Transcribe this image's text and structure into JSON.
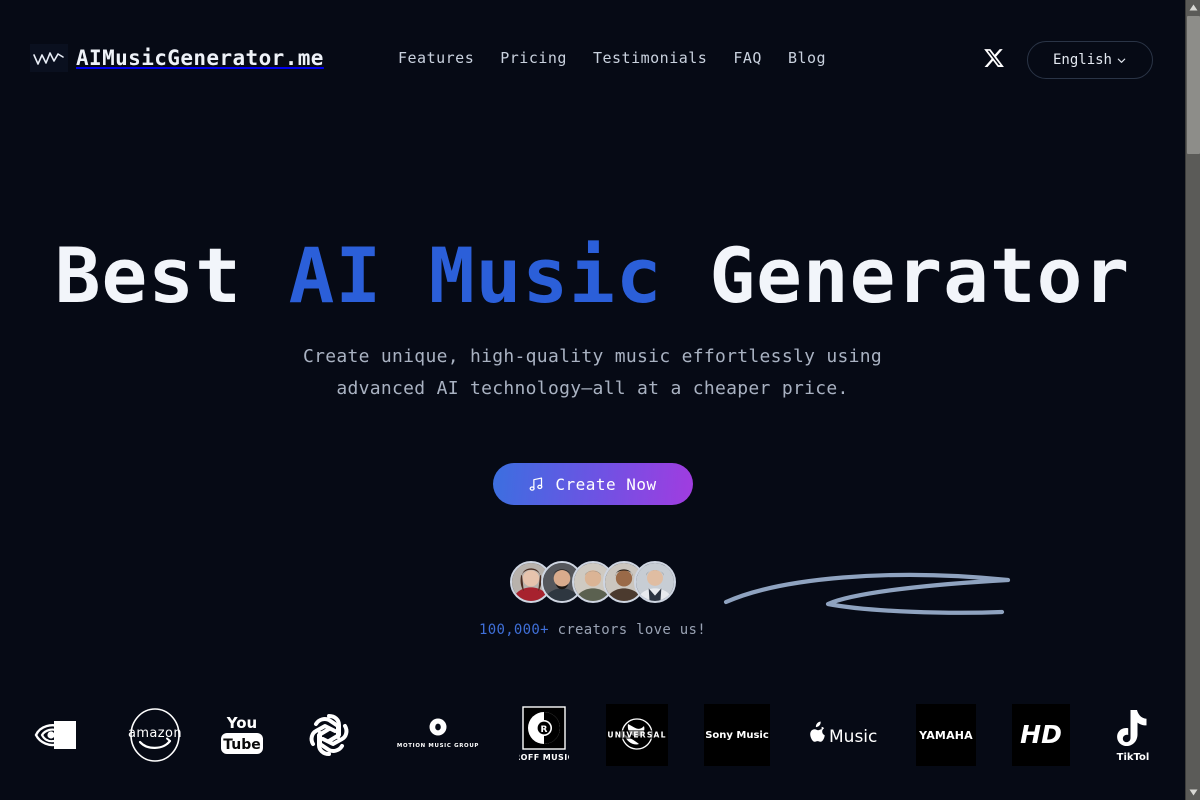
{
  "page": {
    "background_color": "#060a15",
    "accent_blue": "#2b5fd9",
    "cta_gradient_from": "#3b6fe0",
    "cta_gradient_to": "#a13ce0"
  },
  "header": {
    "brand_name": "AIMusicGenerator.me",
    "brand_icon": "waveform-icon",
    "nav": [
      {
        "label": "Features"
      },
      {
        "label": "Pricing"
      },
      {
        "label": "Testimonials"
      },
      {
        "label": "FAQ"
      },
      {
        "label": "Blog"
      }
    ],
    "social": {
      "icon": "x-twitter-icon",
      "label": "X"
    },
    "language": {
      "label": "English",
      "icon": "chevron-down-icon"
    }
  },
  "hero": {
    "headline_part1": "Best ",
    "headline_accent": "AI Music",
    "headline_part2": " Generator",
    "subtitle_line1": "Create unique, high-quality music effortlessly using",
    "subtitle_line2": "advanced AI technology—all at a cheaper price.",
    "cta_label": "Create Now",
    "cta_icon": "music-note-icon",
    "social_proof_count": "100,000+",
    "social_proof_text": " creators love us!",
    "avatar_count": 5
  },
  "logos": [
    {
      "name": "nvidia-logo",
      "label": "NVIDIA"
    },
    {
      "name": "amazon-logo",
      "label": "amazon"
    },
    {
      "name": "youtube-logo",
      "label": "You Tube"
    },
    {
      "name": "openai-logo",
      "label": "OpenAI"
    },
    {
      "name": "motion-music-group-logo",
      "label": "MOTION MUSIC GROUP"
    },
    {
      "name": "roff-music-logo",
      "label": "ROFF MUSIC"
    },
    {
      "name": "universal-logo",
      "label": "UNIVERSAL"
    },
    {
      "name": "sony-music-logo",
      "label": "Sony Music"
    },
    {
      "name": "apple-music-logo",
      "label": "Music"
    },
    {
      "name": "yamaha-logo",
      "label": "YAMAHA"
    },
    {
      "name": "hd-logo",
      "label": "HD"
    },
    {
      "name": "tiktok-logo",
      "label": "TikTol"
    }
  ]
}
